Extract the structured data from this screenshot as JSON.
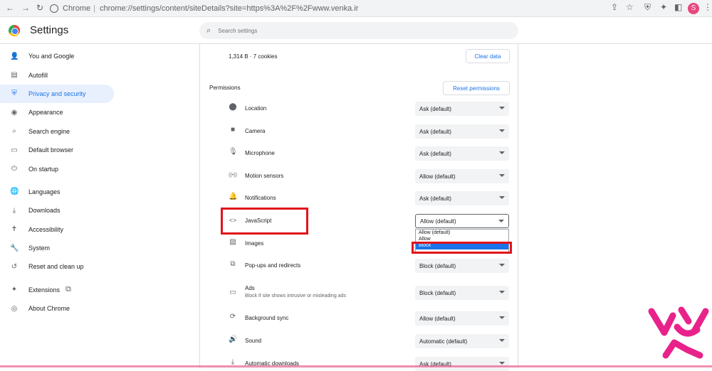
{
  "browser": {
    "back_icon": "back-arrow-icon",
    "forward_icon": "forward-arrow-icon",
    "reload_icon": "reload-icon",
    "chip": "Chrome",
    "separator": "|",
    "url": "chrome://settings/content/siteDetails?site=https%3A%2F%2Fwww.venka.ir",
    "profile_initial": "S"
  },
  "header": {
    "title": "Settings",
    "search_placeholder": "Search settings"
  },
  "sidebar": {
    "items": [
      {
        "label": "You and Google",
        "icon": "person-icon",
        "glyph": "👤"
      },
      {
        "label": "Autofill",
        "icon": "autofill-icon",
        "glyph": "▤"
      },
      {
        "label": "Privacy and security",
        "icon": "shield-icon",
        "glyph": "⛨",
        "active": true
      },
      {
        "label": "Appearance",
        "icon": "palette-icon",
        "glyph": "◉"
      },
      {
        "label": "Search engine",
        "icon": "search-icon",
        "glyph": "⌕"
      },
      {
        "label": "Default browser",
        "icon": "browser-icon",
        "glyph": "▭"
      },
      {
        "label": "On startup",
        "icon": "power-icon",
        "glyph": "⏻"
      },
      {
        "label": "Languages",
        "icon": "globe-icon",
        "glyph": "🌐"
      },
      {
        "label": "Downloads",
        "icon": "download-icon",
        "glyph": "⤓"
      },
      {
        "label": "Accessibility",
        "icon": "accessibility-icon",
        "glyph": "✝"
      },
      {
        "label": "System",
        "icon": "wrench-icon",
        "glyph": "🔧"
      },
      {
        "label": "Reset and clean up",
        "icon": "reset-icon",
        "glyph": "↺"
      },
      {
        "label": "Extensions",
        "icon": "extensions-icon",
        "glyph": "✦"
      },
      {
        "label": "About Chrome",
        "icon": "chrome-icon",
        "glyph": "◎"
      }
    ]
  },
  "main": {
    "usage": "1,314 B · 7 cookies",
    "clear_data": "Clear data",
    "permissions_title": "Permissions",
    "reset_permissions": "Reset permissions",
    "permissions": [
      {
        "label": "Location",
        "value": "Ask (default)",
        "icon": "location-icon",
        "glyph": "⬤"
      },
      {
        "label": "Camera",
        "value": "Ask (default)",
        "icon": "camera-icon",
        "glyph": "■"
      },
      {
        "label": "Microphone",
        "value": "Ask (default)",
        "icon": "microphone-icon",
        "glyph": "🎙"
      },
      {
        "label": "Motion sensors",
        "value": "Allow (default)",
        "icon": "motion-sensor-icon",
        "glyph": "((•))"
      },
      {
        "label": "Notifications",
        "value": "Ask (default)",
        "icon": "bell-icon",
        "glyph": "🔔"
      },
      {
        "label": "JavaScript",
        "value": "Allow (default)",
        "icon": "code-icon",
        "glyph": "<>"
      },
      {
        "label": "Images",
        "value": "",
        "icon": "image-icon",
        "glyph": "▨"
      },
      {
        "label": "Pop-ups and redirects",
        "value": "Block (default)",
        "icon": "popup-icon",
        "glyph": "⧉"
      },
      {
        "label": "Ads",
        "sub": "Block if site shows intrusive or misleading ads",
        "value": "Block (default)",
        "icon": "ads-icon",
        "glyph": "▭"
      },
      {
        "label": "Background sync",
        "value": "Allow (default)",
        "icon": "sync-icon",
        "glyph": "⟳"
      },
      {
        "label": "Sound",
        "value": "Automatic (default)",
        "icon": "sound-icon",
        "glyph": "🔊"
      },
      {
        "label": "Automatic downloads",
        "value": "Ask (default)",
        "icon": "download-icon",
        "glyph": "⤓"
      }
    ],
    "js_dropdown_options": [
      "Allow (default)",
      "Allow",
      "Block"
    ],
    "js_dropdown_selected": 2
  }
}
